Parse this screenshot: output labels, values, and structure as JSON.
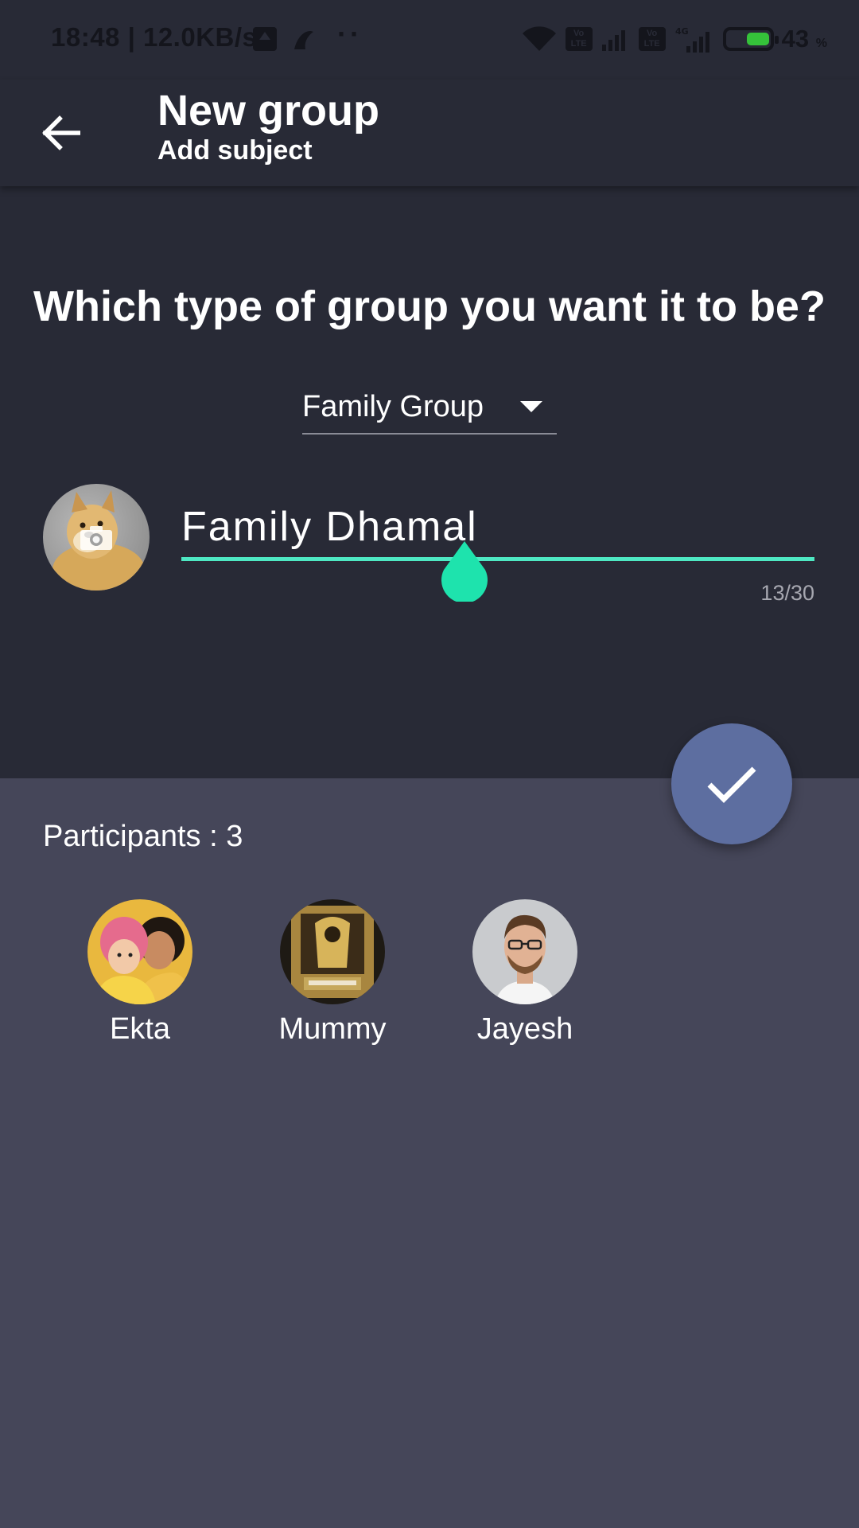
{
  "status_bar": {
    "time_speed": "18:48 | 12.0KB/s",
    "dots": "··",
    "volte1": "Vo LTE",
    "volte2": "Vo LTE",
    "net_4g": "4G",
    "battery_percent": "43",
    "battery_unit": "%"
  },
  "app_bar": {
    "title": "New group",
    "subtitle": "Add subject"
  },
  "form": {
    "question": "Which type of group you want it to be?",
    "group_type": "Family Group",
    "group_name": "Family Dhamal",
    "char_counter": "13/30"
  },
  "participants": {
    "label": "Participants : 3",
    "list": [
      {
        "name": "Ekta"
      },
      {
        "name": "Mummy"
      },
      {
        "name": "Jayesh"
      }
    ]
  },
  "colors": {
    "dark_panel": "#282a36",
    "body_background": "#454659",
    "accent_teal": "#4ee8c3",
    "fab": "#5d6ea0"
  }
}
